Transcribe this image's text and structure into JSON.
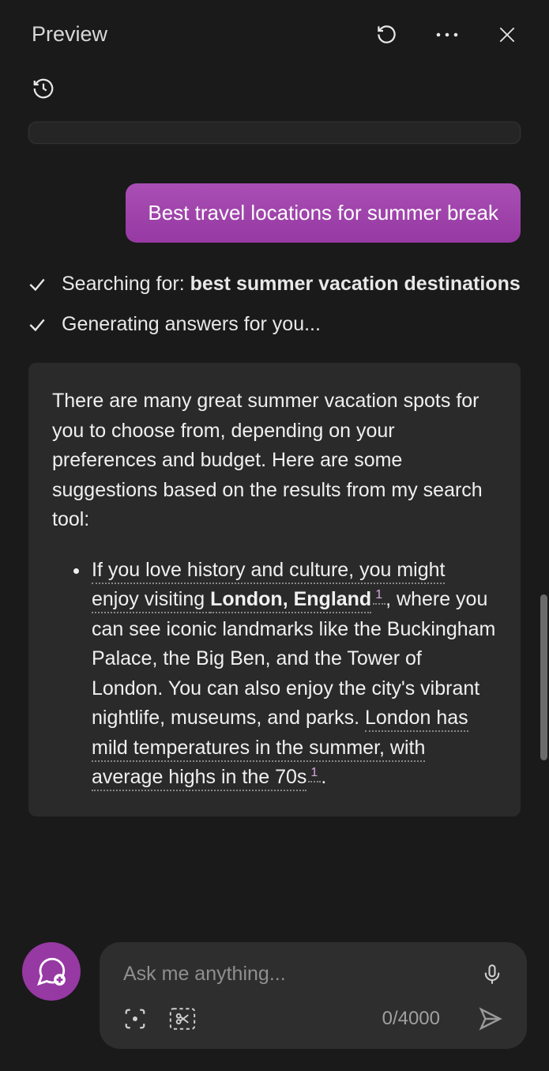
{
  "header": {
    "title": "Preview"
  },
  "user_message": "Best travel locations for summer break",
  "status": {
    "search_prefix": "Searching for: ",
    "search_query": "best summer vacation destinations",
    "generating": "Generating answers for you..."
  },
  "response": {
    "intro": "There are many great summer vacation spots for you to choose from, depending on your preferences and budget. Here are some suggestions based on the results from my search tool:",
    "item": {
      "seg1": "If you love history and culture, you might enjoy visiting ",
      "seg1_bold": "London, England",
      "cite1": "1",
      "seg2": ", where you can see iconic landmarks like the Buckingham Palace, the Big Ben, and the Tower of London. You can also enjoy the city's vibrant nightlife, museums, and parks. ",
      "seg3": "London has mild temperatures in the summer, with average highs in the 70s",
      "cite2": "1",
      "seg4": "."
    }
  },
  "composer": {
    "placeholder": "Ask me anything...",
    "char_count": "0/4000"
  }
}
